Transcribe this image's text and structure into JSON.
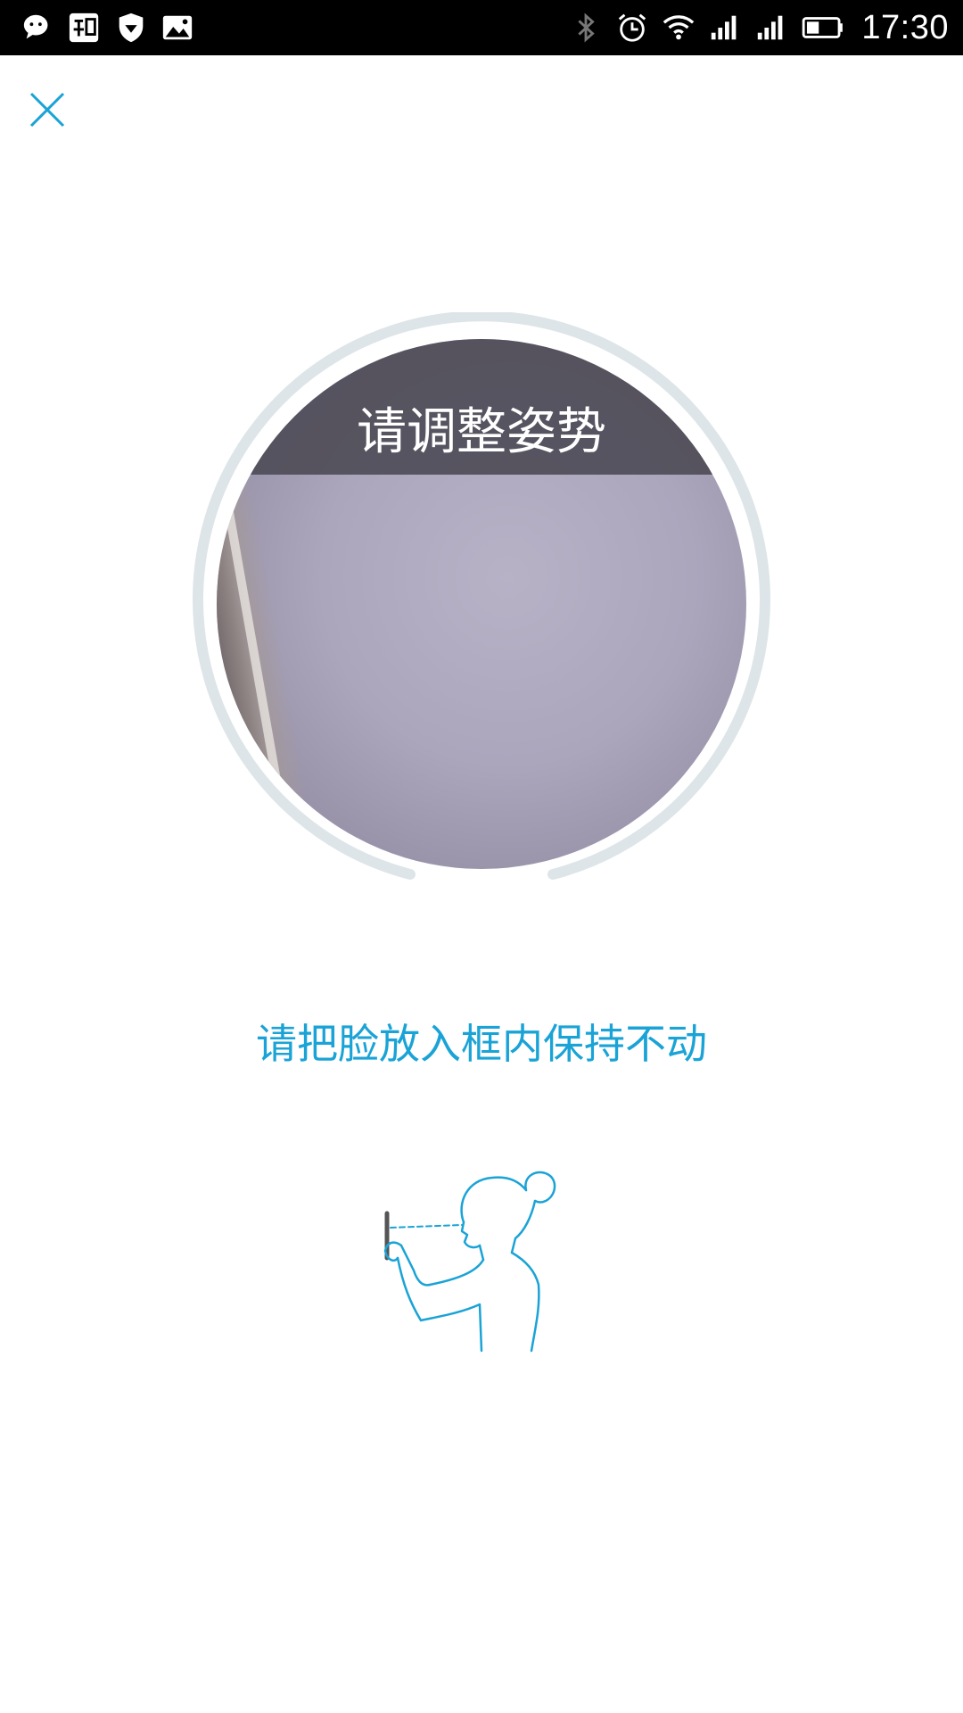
{
  "status_bar": {
    "time": "17:30",
    "left_icons": [
      "wechat-icon",
      "zhihu-icon",
      "shield-icon",
      "image-icon"
    ],
    "right_icons": [
      "bluetooth-icon",
      "alarm-icon",
      "wifi-icon",
      "signal-icon",
      "signal-icon",
      "battery-icon"
    ]
  },
  "close_icon": "close-icon",
  "camera": {
    "banner_text": "请调整姿势"
  },
  "instruction": "请把脸放入框内保持不动",
  "illustration_icon": "person-holding-phone-icon",
  "colors": {
    "accent": "#1aa3d6",
    "ring": "#dde5e8",
    "banner": "#504e58"
  }
}
